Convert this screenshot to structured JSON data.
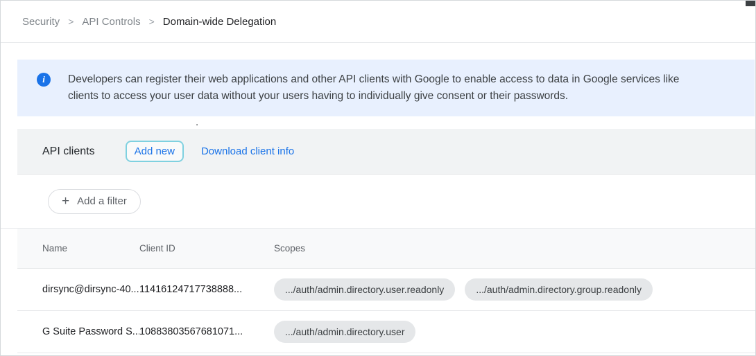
{
  "colors": {
    "accent_blue": "#1a73e8",
    "banner_bg": "#e8f0fe",
    "band_bg": "#f1f3f4",
    "chip_bg": "#e5e7e9",
    "border": "#e6e8ea",
    "text_dark": "#202124",
    "text_gray": "#5f6368",
    "add_new_outline": "#7fd1e0"
  },
  "icons": {
    "info": "i",
    "plus": "+"
  },
  "breadcrumb": {
    "separator": ">",
    "items": [
      {
        "label": "Security"
      },
      {
        "label": "API Controls"
      },
      {
        "label": "Domain-wide Delegation"
      }
    ]
  },
  "banner": {
    "line1": "Developers can register their web applications and other API clients with Google to enable access to data in Google services like",
    "line2": "clients to access your user data without your users having to individually give consent or their passwords.",
    "truncated": "."
  },
  "api_clients": {
    "title": "API clients",
    "add_new_label": "Add new",
    "download_label": "Download client info",
    "filter_label": "Add a filter"
  },
  "table": {
    "headers": [
      "Name",
      "Client ID",
      "Scopes"
    ],
    "rows": [
      {
        "name": "dirsync@dirsync-40...",
        "client_id": "11416124717738888...",
        "scopes": [
          ".../auth/admin.directory.user.readonly",
          ".../auth/admin.directory.group.readonly"
        ]
      },
      {
        "name": "G Suite Password S...",
        "client_id": "10883803567681071...",
        "scopes": [
          ".../auth/admin.directory.user"
        ]
      }
    ]
  }
}
